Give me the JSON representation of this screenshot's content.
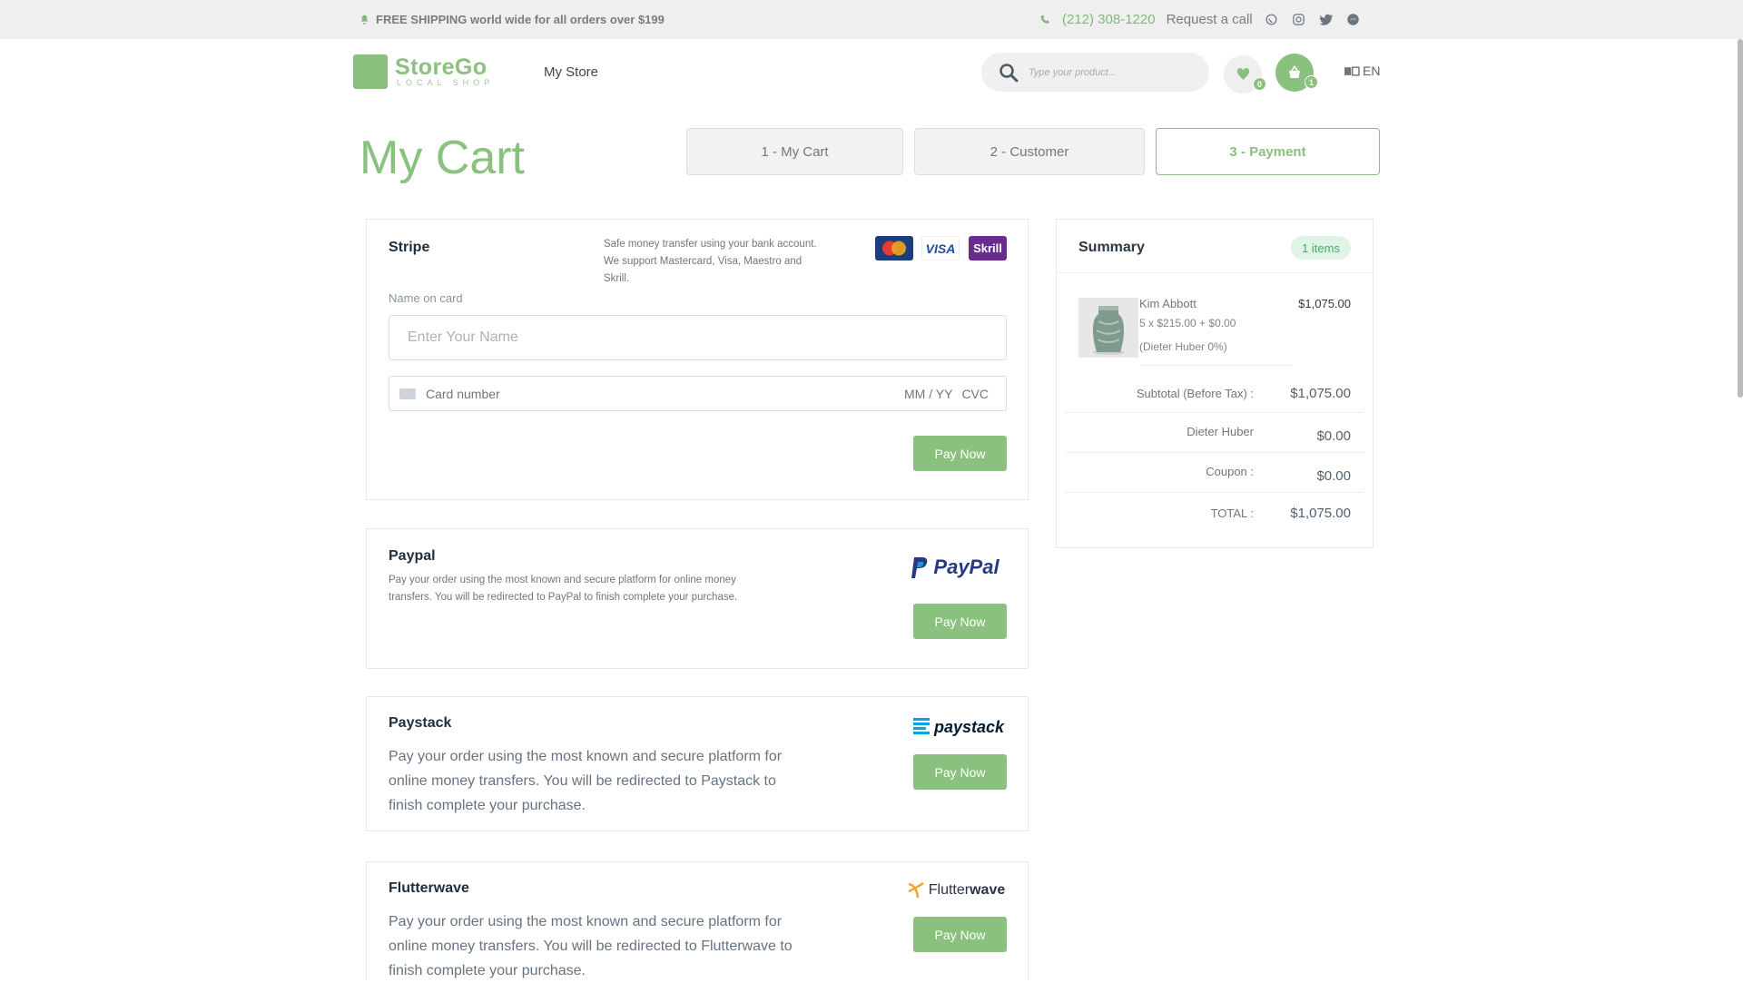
{
  "topbar": {
    "notice": "FREE SHIPPING world wide for all orders over $199",
    "phone": "(212) 308-1220",
    "request_call": "Request a call",
    "icons": [
      "whatsapp-icon",
      "instagram-icon",
      "twitter-icon",
      "messenger-icon"
    ]
  },
  "header": {
    "logo_name": "StoreGo",
    "logo_sub": "LOCAL SHOP",
    "nav_store": "My Store",
    "search_placeholder": "Type your product...",
    "wishlist_count": "0",
    "cart_count": "1",
    "language": "EN"
  },
  "page": {
    "title": "My Cart",
    "steps": [
      "1 - My Cart",
      "2 - Customer",
      "3 - Payment"
    ],
    "active_step": 2
  },
  "payments": {
    "stripe": {
      "name": "Stripe",
      "desc": [
        "Safe money transfer using your bank account.",
        "We support Mastercard, Visa, Maestro and Skrill."
      ],
      "label_name": "Name on card",
      "placeholder_name": "Enter Your Name",
      "card_number": "Card number",
      "card_exp": "MM / YY",
      "card_cvc": "CVC",
      "button": "Pay Now",
      "logos": [
        "MasterCard",
        "VISA",
        "Skrill"
      ]
    },
    "paypal": {
      "name": "Paypal",
      "desc": [
        "Pay your order using the most known and secure platform for online money",
        "transfers. You will be redirected to PayPal to finish complete your purchase."
      ],
      "logo": "PayPal",
      "button": "Pay Now"
    },
    "paystack": {
      "name": "Paystack",
      "desc": "Pay your order using the most known and secure platform for online money transfers. You will be redirected to Paystack to finish complete your purchase.",
      "logo": "paystack",
      "button": "Pay Now"
    },
    "flutterwave": {
      "name": "Flutterwave",
      "desc": "Pay your order using the most known and secure platform for online money transfers. You will be redirected to Flutterwave to finish complete your purchase.",
      "logo_a": "Flutter",
      "logo_b": "wave",
      "button": "Pay Now"
    }
  },
  "summary": {
    "title": "Summary",
    "items_badge": "1 items",
    "product": {
      "name": "Kim Abbott",
      "meta": "5 x $215.00 + $0.00",
      "tax": "(Dieter Huber 0%)",
      "price": "$1,075.00"
    },
    "rows": [
      {
        "label": "Subtotal (Before Tax) :",
        "value": "$1,075.00"
      },
      {
        "label": "Dieter Huber",
        "value": "$0.00"
      },
      {
        "label": "Coupon :",
        "value": "$0.00"
      },
      {
        "label": "TOTAL :",
        "value": "$1,075.00"
      }
    ]
  },
  "colors": {
    "accent": "#8ac17f",
    "topbar_bg": "#efefef",
    "badge_bg": "#dff4e7",
    "badge_text": "#47a96b"
  }
}
